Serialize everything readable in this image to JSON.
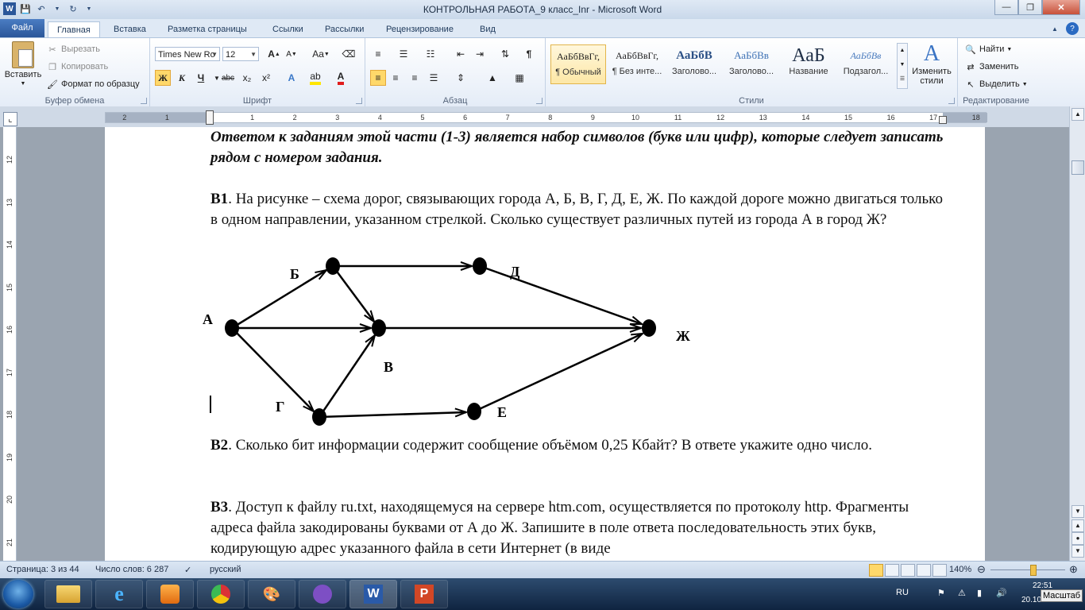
{
  "window": {
    "title": "КОНТРОЛЬНАЯ РАБОТА_9 класс_Inr  -  Microsoft Word"
  },
  "tabs": {
    "file": "Файл",
    "items": [
      "Главная",
      "Вставка",
      "Разметка страницы",
      "Ссылки",
      "Рассылки",
      "Рецензирование",
      "Вид"
    ]
  },
  "ribbon": {
    "clipboard": {
      "paste": "Вставить",
      "cut": "Вырезать",
      "copy": "Копировать",
      "format_painter": "Формат по образцу",
      "label": "Буфер обмена"
    },
    "font": {
      "name": "Times New Ro",
      "size": "12",
      "label": "Шрифт",
      "bold": "Ж",
      "italic": "К",
      "underline": "Ч",
      "strike": "abc",
      "subscript": "x₂",
      "superscript": "x²",
      "grow": "A",
      "shrink": "A",
      "case": "Aa"
    },
    "paragraph": {
      "label": "Абзац"
    },
    "styles": {
      "label": "Стили",
      "items": [
        {
          "sample": "АаБбВвГг,",
          "name": "¶ Обычный"
        },
        {
          "sample": "АаБбВвГг,",
          "name": "¶ Без инте..."
        },
        {
          "sample": "АаБбВ",
          "name": "Заголово..."
        },
        {
          "sample": "АаБбВв",
          "name": "Заголово..."
        },
        {
          "sample": "АаБ",
          "name": "Название"
        },
        {
          "sample": "АаБбВв",
          "name": "Подзагол..."
        }
      ],
      "change": "Изменить стили"
    },
    "editing": {
      "label": "Редактирование",
      "find": "Найти",
      "replace": "Заменить",
      "select": "Выделить"
    }
  },
  "ruler": {
    "numbers": [
      "2",
      "1",
      "1",
      "2",
      "3",
      "4",
      "5",
      "6",
      "7",
      "8",
      "9",
      "10",
      "11",
      "12",
      "13",
      "14",
      "15",
      "16",
      "17",
      "18"
    ],
    "vnumbers": [
      "12",
      "13",
      "14",
      "15",
      "16",
      "17",
      "18",
      "19",
      "20",
      "21"
    ]
  },
  "document": {
    "intro": "Ответом к заданиям этой части (1-3) является набор символов (букв или цифр), которые следует записать рядом с номером задания.",
    "b1": {
      "num": "В1",
      "text": ". На рисунке – схема дорог, связывающих города А, Б, В, Г, Д, Е, Ж. По каждой дороге можно двигаться только в одном направлении, указанном стрелкой. Сколько существует различных путей из города А в город Ж?"
    },
    "graph": {
      "nodes": [
        "А",
        "Б",
        "В",
        "Г",
        "Д",
        "Е",
        "Ж"
      ]
    },
    "b2": {
      "num": "В2",
      "text": ". Сколько бит информации содержит сообщение объёмом 0,25 Кбайт? В ответе укажите одно число."
    },
    "b3": {
      "num": "В3",
      "text": ". Доступ к файлу ru.txt, находящемуся на сервере htm.com, осуществляется по протоколу http. Фрагменты адреса файла закодированы буквами от А до Ж. Запишите в поле ответа последовательность этих букв, кодирующую адрес указанного файла в сети Интернет (в виде"
    }
  },
  "status": {
    "page": "Страница: 3 из 44",
    "words": "Число слов: 6 287",
    "language": "русский",
    "zoom": "140%",
    "zoom_level_percent": 140
  },
  "taskbar": {
    "lang": "RU",
    "time": "22:51",
    "date": "20.10.2015",
    "tooltip": "Масштаб"
  },
  "colors": {
    "accent": "#2a5699",
    "ribbon_bg": "#e4ecf7",
    "taskbar": "#1a3556"
  }
}
